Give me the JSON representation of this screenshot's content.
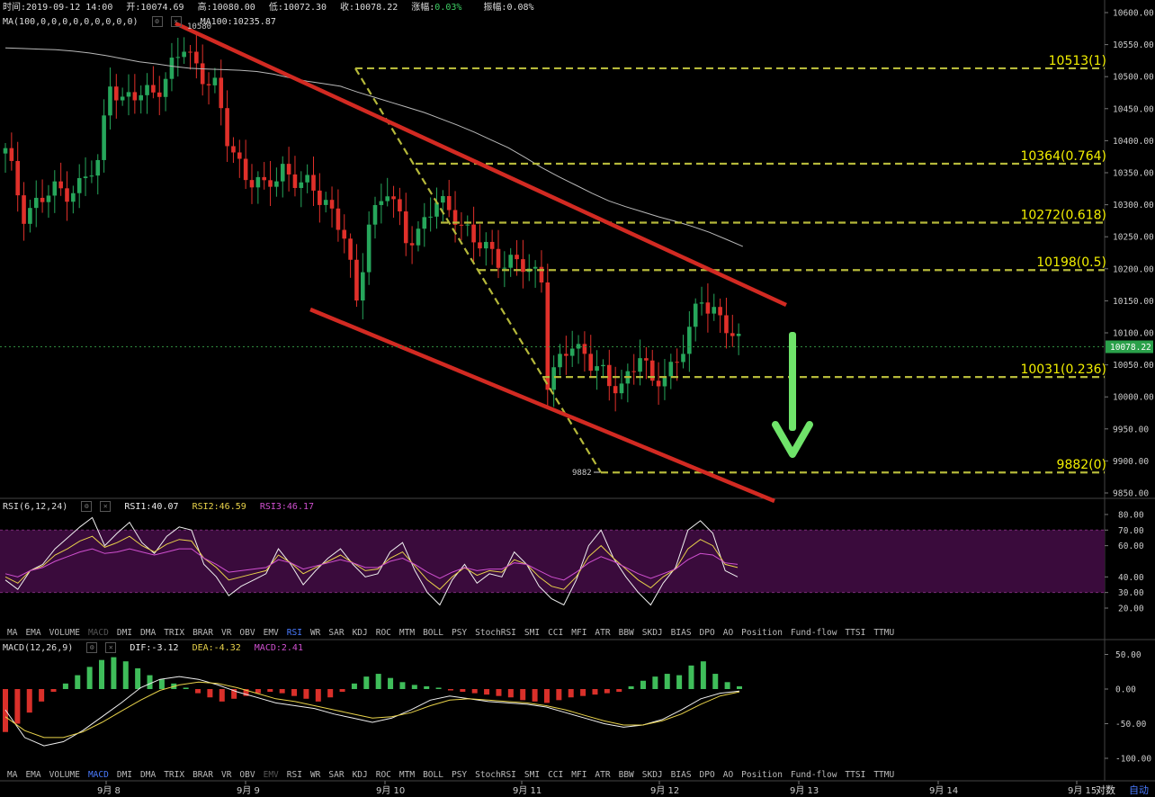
{
  "header": {
    "time": "时间:2019-09-12 14:00",
    "open": "开:10074.69",
    "high": "高:10080.00",
    "low": "低:10072.30",
    "close": "收:10078.22",
    "change_label": "涨幅:",
    "change_value": "0.03%",
    "amplitude": "振幅:0.08%",
    "ma_params": "MA(100,0,0,0,0,0,0,0,0,0)",
    "ma100": "MA100:10235.87"
  },
  "rsi_header": {
    "params": "RSI(6,12,24)",
    "rsi1": "RSI1:40.07",
    "rsi2": "RSI2:46.59",
    "rsi3": "RSI3:46.17"
  },
  "macd_header": {
    "params": "MACD(12,26,9)",
    "dif": "DIF:-3.12",
    "dea": "DEA:-4.32",
    "macd": "MACD:2.41"
  },
  "indicator_tabs": [
    "MA",
    "EMA",
    "VOLUME",
    "MACD",
    "DMI",
    "DMA",
    "TRIX",
    "BRAR",
    "VR",
    "OBV",
    "EMV",
    "RSI",
    "WR",
    "SAR",
    "KDJ",
    "ROC",
    "MTM",
    "BOLL",
    "PSY",
    "StochRSI",
    "SMI",
    "CCI",
    "MFI",
    "ATR",
    "BBW",
    "SKDJ",
    "BIAS",
    "DPO",
    "AO",
    "Position",
    "Fund-flow",
    "TTSI",
    "TTMU"
  ],
  "upper_active_tab": "RSI",
  "upper_dim_tab": "MACD",
  "lower_active_tab": "MACD",
  "lower_dim_tab": "EMV",
  "controls": {
    "log_label": "对数",
    "auto_label": "自动"
  },
  "colors": {
    "up": "#26a65b",
    "down": "#e0302a",
    "trend": "#d22a22",
    "fib": "#b5b83a",
    "fib_label": "#f3f000",
    "arrow": "#6fe36a",
    "ma": "#b8b8b8",
    "rsi_band": "#3a0b3c"
  },
  "chart_data": [
    {
      "type": "candlestick",
      "title": "",
      "x_ticks": [
        "9月 8",
        "9月 9",
        "9月 10",
        "9月 11",
        "9月 12",
        "9月 13",
        "9月 14",
        "9月 15"
      ],
      "y_ticks": [
        9850,
        9900,
        9950,
        10000,
        10050,
        10100,
        10150,
        10200,
        10250,
        10300,
        10350,
        10400,
        10450,
        10500,
        10550,
        10600
      ],
      "y_tick_labels": [
        "9850.00",
        "9900.00",
        "9950.00",
        "10000.00",
        "10050.00",
        "10100.00",
        "10150.00",
        "10200.00",
        "10250.00",
        "10300.00",
        "10350.00",
        "10400.00",
        "10450.00",
        "10500.00",
        "10550.00",
        "10600.00"
      ],
      "ylim": [
        9840,
        10610
      ],
      "last_price": 10078.22,
      "last_price_label": "10078.22",
      "high_marker": {
        "label": "10580",
        "value": 10580
      },
      "low_marker": {
        "label": "9882",
        "value": 9882
      },
      "fib_levels": [
        {
          "value": 10513,
          "label": "10513(1)"
        },
        {
          "value": 10364,
          "label": "10364(0.764)"
        },
        {
          "value": 10272,
          "label": "10272(0.618)"
        },
        {
          "value": 10198,
          "label": "10198(0.5)"
        },
        {
          "value": 10031,
          "label": "10031(0.236)"
        },
        {
          "value": 9882,
          "label": "9882(0)"
        }
      ],
      "ma100": [
        10545,
        10544,
        10543,
        10542,
        10540,
        10537,
        10533,
        10528,
        10523,
        10520,
        10516,
        10513,
        10512,
        10511,
        10510,
        10508,
        10504,
        10498,
        10493,
        10489,
        10485,
        10476,
        10468,
        10460,
        10452,
        10444,
        10434,
        10424,
        10413,
        10401,
        10389,
        10374,
        10358,
        10344,
        10331,
        10318,
        10306,
        10297,
        10289,
        10281,
        10274,
        10266,
        10257,
        10246,
        10235
      ],
      "trend_lines": [
        {
          "from": [
            1,
            10575
          ],
          "to": [
            50,
            10145
          ]
        },
        {
          "from": [
            19,
            10145
          ],
          "to": [
            49,
            9840
          ]
        }
      ],
      "fib_diagonal": {
        "from": [
          22,
          10513
        ],
        "to": [
          38,
          9882
        ]
      }
    },
    {
      "type": "line",
      "title": "",
      "y_ticks": [
        20,
        30,
        40,
        60,
        70,
        80
      ],
      "y_tick_labels": [
        "20.00",
        "30.00",
        "40.00",
        "60.00",
        "70.00",
        "80.00"
      ],
      "band": [
        30,
        70
      ],
      "ylim": [
        11,
        84
      ],
      "series": [
        {
          "name": "RSI1",
          "values": [
            38,
            32,
            44,
            48,
            58,
            65,
            72,
            78,
            60,
            68,
            75,
            62,
            55,
            66,
            72,
            70,
            48,
            40,
            28,
            34,
            38,
            42,
            58,
            48,
            35,
            44,
            52,
            58,
            48,
            40,
            42,
            56,
            62,
            44,
            30,
            22,
            38,
            48,
            36,
            42,
            40,
            56,
            48,
            34,
            26,
            22,
            38,
            60,
            70,
            52,
            40,
            30,
            22,
            36,
            46,
            70,
            76,
            68,
            44,
            40
          ]
        },
        {
          "name": "RSI2",
          "values": [
            40,
            36,
            44,
            47,
            54,
            58,
            63,
            66,
            59,
            62,
            66,
            60,
            56,
            61,
            64,
            63,
            52,
            46,
            38,
            40,
            42,
            44,
            54,
            49,
            42,
            46,
            50,
            54,
            49,
            44,
            45,
            52,
            56,
            47,
            38,
            32,
            40,
            46,
            41,
            44,
            43,
            51,
            48,
            40,
            34,
            32,
            40,
            53,
            60,
            52,
            45,
            38,
            33,
            40,
            45,
            58,
            64,
            60,
            48,
            46
          ]
        },
        {
          "name": "RSI3",
          "values": [
            42,
            40,
            44,
            46,
            50,
            53,
            56,
            58,
            55,
            56,
            58,
            56,
            54,
            56,
            58,
            58,
            52,
            48,
            43,
            44,
            45,
            46,
            51,
            49,
            45,
            47,
            49,
            51,
            49,
            46,
            46,
            50,
            52,
            48,
            43,
            39,
            43,
            46,
            44,
            45,
            45,
            49,
            48,
            44,
            40,
            38,
            43,
            49,
            53,
            50,
            46,
            42,
            39,
            42,
            45,
            51,
            55,
            54,
            49,
            48
          ]
        }
      ]
    },
    {
      "type": "bar",
      "title": "",
      "y_ticks": [
        -100,
        -50,
        0,
        50
      ],
      "y_tick_labels": [
        "-100.00",
        "-50.00",
        "0.00",
        "50.00"
      ],
      "ylim": [
        -112,
        62
      ],
      "histogram": [
        -62,
        -50,
        -34,
        -18,
        -4,
        8,
        20,
        32,
        42,
        46,
        40,
        30,
        20,
        14,
        8,
        2,
        -6,
        -12,
        -18,
        -14,
        -10,
        -6,
        -4,
        -6,
        -10,
        -14,
        -18,
        -12,
        -4,
        8,
        18,
        22,
        16,
        10,
        6,
        4,
        2,
        -2,
        -4,
        -6,
        -8,
        -10,
        -12,
        -16,
        -18,
        -20,
        -16,
        -12,
        -10,
        -8,
        -6,
        -4,
        4,
        12,
        18,
        22,
        20,
        34,
        40,
        22,
        10,
        4
      ],
      "series": [
        {
          "name": "DIF",
          "values": [
            -30,
            -70,
            -82,
            -76,
            -60,
            -40,
            -20,
            2,
            14,
            18,
            14,
            6,
            -4,
            -12,
            -20,
            -24,
            -28,
            -36,
            -42,
            -48,
            -42,
            -30,
            -16,
            -10,
            -14,
            -18,
            -20,
            -22,
            -26,
            -34,
            -42,
            -50,
            -55,
            -52,
            -44,
            -30,
            -14,
            -6,
            -3
          ]
        },
        {
          "name": "DEA",
          "values": [
            -40,
            -60,
            -70,
            -70,
            -62,
            -48,
            -32,
            -16,
            -2,
            6,
            10,
            8,
            2,
            -6,
            -14,
            -18,
            -24,
            -30,
            -36,
            -42,
            -40,
            -34,
            -24,
            -16,
            -14,
            -16,
            -18,
            -20,
            -24,
            -30,
            -38,
            -46,
            -52,
            -52,
            -46,
            -36,
            -22,
            -10,
            -4
          ]
        }
      ]
    }
  ]
}
